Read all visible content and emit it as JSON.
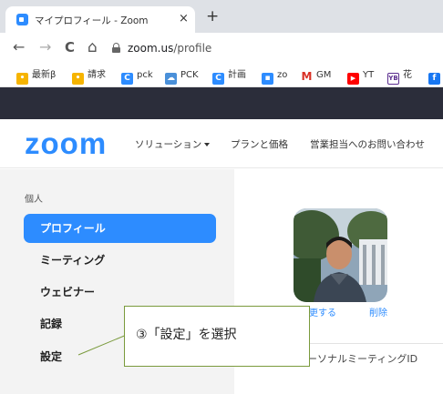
{
  "browser": {
    "tab_title": "マイプロフィール - Zoom",
    "tab_close": "×",
    "new_tab": "+",
    "back": "←",
    "forward": "→",
    "reload": "C",
    "home": "⌂",
    "url_host": "zoom.us",
    "url_path": "/profile",
    "bookmarks": [
      {
        "label": "最新β",
        "icon": "emoji-face-icon",
        "color": "#f6b400"
      },
      {
        "label": "請求",
        "icon": "emoji-face-icon",
        "color": "#f6b400"
      },
      {
        "label": "pck",
        "icon": "c-app-icon",
        "color": "#2d8cff"
      },
      {
        "label": "PCK",
        "icon": "cloud-icon",
        "color": "#4a90d9"
      },
      {
        "label": "計画",
        "icon": "c-app-icon",
        "color": "#2d8cff"
      },
      {
        "label": "zo",
        "icon": "zoom-camera-icon",
        "color": "#2d8cff"
      },
      {
        "label": "GM",
        "icon": "gmail-icon",
        "color": "#d93025"
      },
      {
        "label": "YT",
        "icon": "youtube-icon",
        "color": "#ff0000"
      },
      {
        "label": "花",
        "icon": "yb-icon",
        "color": "#5b2d8e"
      },
      {
        "label": "",
        "icon": "facebook-icon",
        "color": "#1877f2"
      }
    ]
  },
  "zoom": {
    "logo": "zoom",
    "nav": {
      "solutions": "ソリューション",
      "pricing": "プランと価格",
      "contact_sales": "営業担当へのお問い合わせ"
    },
    "sidebar": {
      "section": "個人",
      "items": [
        {
          "label": "プロフィール",
          "active": true
        },
        {
          "label": "ミーティング",
          "active": false
        },
        {
          "label": "ウェビナー",
          "active": false
        },
        {
          "label": "記録",
          "active": false
        },
        {
          "label": "設定",
          "active": false
        }
      ]
    },
    "profile": {
      "change_link": "更する",
      "delete_link": "削除",
      "pmi_label": "ーソナルミーティングID"
    }
  },
  "annotation": {
    "text": "③「設定」を選択"
  },
  "colors": {
    "accent": "#2d8cff",
    "header_dark": "#2b2d3a",
    "sidebar_bg": "#f3f3f3",
    "callout_border": "#7a9a3c"
  }
}
